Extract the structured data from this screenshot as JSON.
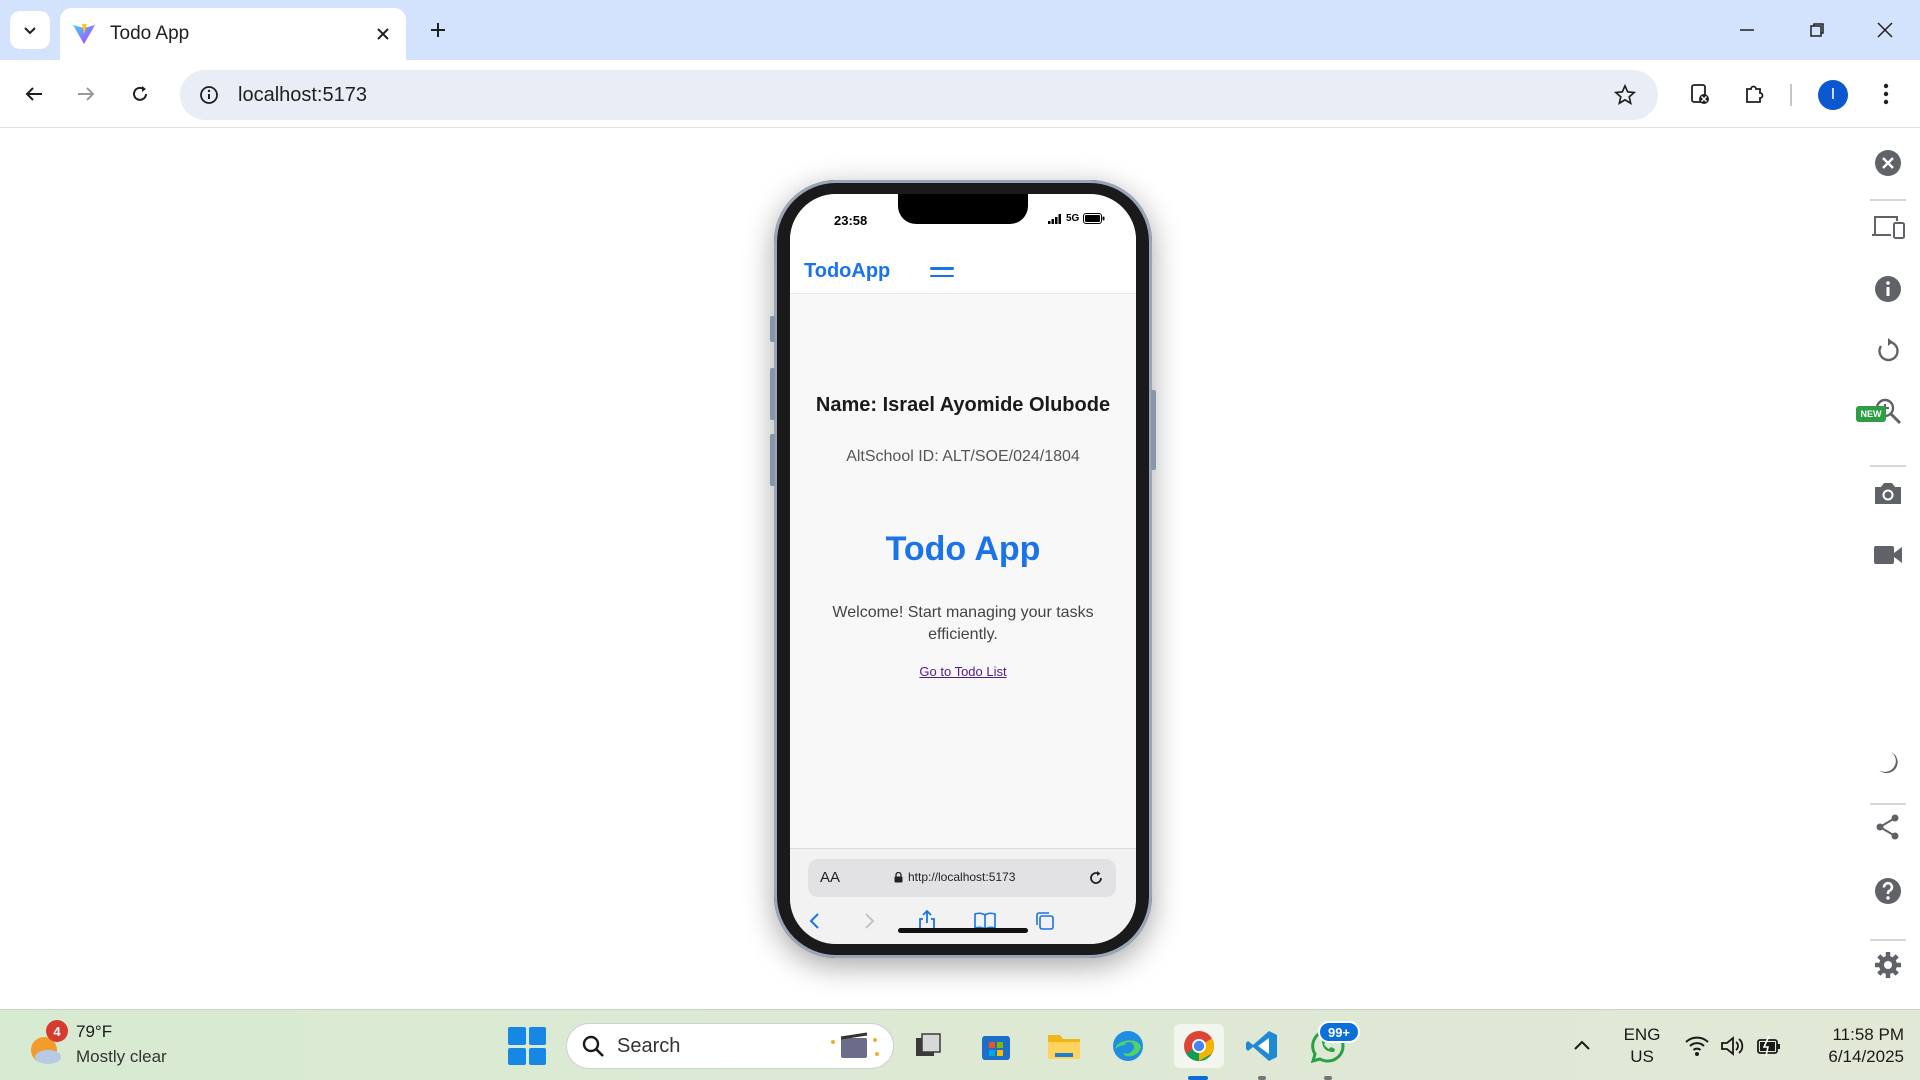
{
  "browser": {
    "tab_title": "Todo App",
    "url": "localhost:5173",
    "profile_initial": "I"
  },
  "phone": {
    "time": "23:58",
    "network": "5G",
    "brand": "TodoApp",
    "name_line": "Name: Israel Ayomide Olubode",
    "altschool_id": "AltSchool ID: ALT/SOE/024/1804",
    "title": "Todo App",
    "welcome": "Welcome! Start managing your tasks efficiently.",
    "link": "Go to Todo List",
    "text_size_button": "AA",
    "safari_url": "http://localhost:5173"
  },
  "devtools": {
    "new_badge": "NEW"
  },
  "taskbar": {
    "weather_temp": "79°F",
    "weather_desc": "Mostly clear",
    "weather_badge": "4",
    "search_label": "Search",
    "whatsapp_badge": "99+",
    "lang_line1": "ENG",
    "lang_line2": "US",
    "time": "11:58 PM",
    "date": "6/14/2025"
  },
  "colors": {
    "brand_blue": "#1a73e8",
    "tab_strip": "#d3e3fd",
    "link_purple": "#551a8b"
  }
}
